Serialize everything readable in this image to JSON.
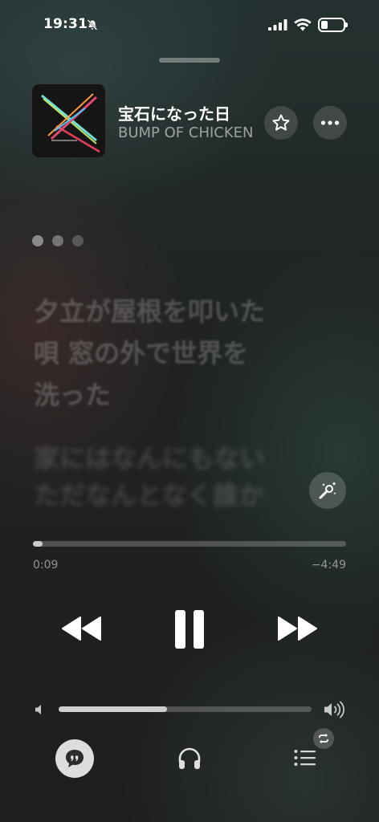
{
  "status_bar": {
    "time": "19:31"
  },
  "now_playing": {
    "title": "宝石になった日",
    "artist": "BUMP OF CHICKEN"
  },
  "lyrics": {
    "current": [
      "夕立が屋根を叩いた",
      "唄 窓の外で世界を",
      "洗った"
    ],
    "next": [
      "家にはなんにもない",
      "ただなんとなく誰か"
    ]
  },
  "playback": {
    "elapsed": "0:09",
    "remaining": "−4:49",
    "progress_fraction": 0.03,
    "volume_fraction": 0.43
  },
  "icons": {
    "silent": "bell-slash-icon",
    "favorite": "star-icon",
    "more": "ellipsis-icon",
    "karaoke": "microphone-sparkle-icon",
    "lyrics": "quote-bubble-icon",
    "output": "headphones-icon",
    "queue": "list-icon",
    "repeat": "repeat-icon"
  }
}
